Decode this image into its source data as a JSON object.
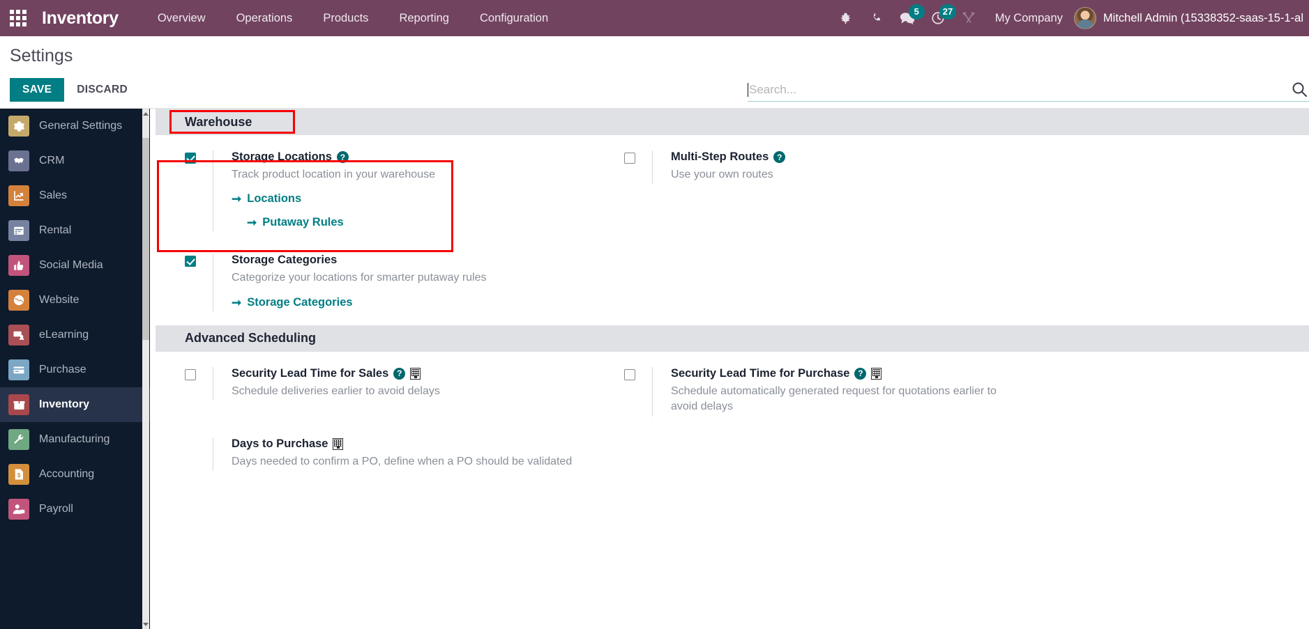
{
  "navbar": {
    "apps_icon": "apps-grid-icon",
    "brand": "Inventory",
    "menu": [
      "Overview",
      "Operations",
      "Products",
      "Reporting",
      "Configuration"
    ],
    "sys_icons": [
      {
        "name": "bug-icon",
        "badge": null
      },
      {
        "name": "phone-icon",
        "badge": null
      },
      {
        "name": "messages-icon",
        "badge": "5"
      },
      {
        "name": "activities-clock-icon",
        "badge": "27"
      },
      {
        "name": "tools-icon",
        "badge": null
      }
    ],
    "company": "My Company",
    "user_name": "Mitchell Admin (15338352-saas-15-1-al",
    "bg_color": "#71435f",
    "accent_color": "#017e84"
  },
  "control_panel": {
    "title": "Settings",
    "save_label": "SAVE",
    "discard_label": "DISCARD",
    "search_placeholder": "Search...",
    "search_value": ""
  },
  "sidebar": {
    "items": [
      {
        "label": "General Settings",
        "icon": "gear-icon",
        "color": "#c5a96b",
        "glyph": "⚙",
        "active": false
      },
      {
        "label": "CRM",
        "icon": "handshake-icon",
        "color": "#6b7190",
        "glyph": "✿",
        "active": false
      },
      {
        "label": "Sales",
        "icon": "chart-up-icon",
        "color": "#d4813c",
        "glyph": "↗",
        "active": false
      },
      {
        "label": "Rental",
        "icon": "calendar-icon",
        "color": "#7782a0",
        "glyph": "▤",
        "active": false
      },
      {
        "label": "Social Media",
        "icon": "thumbs-up-icon",
        "color": "#c2547c",
        "glyph": "✋",
        "active": false
      },
      {
        "label": "Website",
        "icon": "globe-icon",
        "color": "#d4813c",
        "glyph": "⊕",
        "active": false
      },
      {
        "label": "eLearning",
        "icon": "elearning-icon",
        "color": "#a94f55",
        "glyph": "▶",
        "active": false
      },
      {
        "label": "Purchase",
        "icon": "credit-card-icon",
        "color": "#7ba6c4",
        "glyph": "▭",
        "active": false
      },
      {
        "label": "Inventory",
        "icon": "box-icon",
        "color": "#a8484c",
        "glyph": "⬛",
        "active": true
      },
      {
        "label": "Manufacturing",
        "icon": "wrench-icon",
        "color": "#6fa882",
        "glyph": "⚒",
        "active": false
      },
      {
        "label": "Accounting",
        "icon": "invoice-icon",
        "color": "#d48f3c",
        "glyph": "$",
        "active": false
      },
      {
        "label": "Payroll",
        "icon": "payroll-icon",
        "color": "#c2547c",
        "glyph": "☺",
        "active": false
      }
    ]
  },
  "sections": [
    {
      "name": "warehouse",
      "heading": "Warehouse",
      "settings": {
        "storage_locations": {
          "title": "Storage Locations",
          "description": "Track product location in your warehouse",
          "checked": true,
          "help_icon": "question-mark-icon",
          "links": [
            {
              "label": "Locations",
              "icon": "arrow-right-icon",
              "indent": false
            },
            {
              "label": "Putaway Rules",
              "icon": "arrow-right-icon",
              "indent": true
            }
          ]
        },
        "multi_step_routes": {
          "title": "Multi-Step Routes",
          "description": "Use your own routes",
          "checked": false,
          "help_icon": "question-mark-icon",
          "links": []
        },
        "storage_categories": {
          "title": "Storage Categories",
          "description": "Categorize your locations for smarter putaway rules",
          "checked": true,
          "help_icon": null,
          "links": [
            {
              "label": "Storage Categories",
              "icon": "arrow-right-icon",
              "indent": false
            }
          ]
        }
      }
    },
    {
      "name": "advanced_scheduling",
      "heading": "Advanced Scheduling",
      "settings": {
        "security_lead_sales": {
          "title": "Security Lead Time for Sales",
          "description": "Schedule deliveries earlier to avoid delays",
          "checked": false,
          "help_icon": "question-mark-icon",
          "company_icon": "company-building-icon",
          "links": []
        },
        "security_lead_purchase": {
          "title": "Security Lead Time for Purchase",
          "description": "Schedule automatically generated request for quotations earlier to avoid delays",
          "checked": false,
          "help_icon": "question-mark-icon",
          "company_icon": "company-building-icon",
          "links": []
        },
        "days_to_purchase": {
          "title": "Days to Purchase",
          "description": "Days needed to confirm a PO, define when a PO should be validated",
          "checked": null,
          "help_icon": null,
          "company_icon": "company-building-icon",
          "links": []
        }
      }
    }
  ],
  "annotations": [
    {
      "name": "warehouse-heading-highlight",
      "color": "#f50000"
    },
    {
      "name": "storage-locations-highlight",
      "color": "#f50000"
    }
  ]
}
